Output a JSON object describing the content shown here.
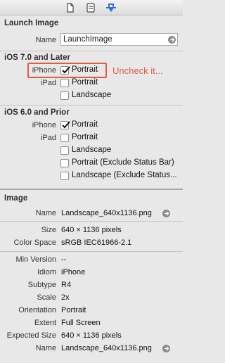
{
  "toolbar": {
    "icons": [
      "file-icon",
      "quick-help-icon",
      "attributes-inspector-icon"
    ],
    "active_color": "#2b6fd6"
  },
  "launch_image": {
    "title": "Launch Image",
    "name_label": "Name",
    "name_value": "LaunchImage"
  },
  "ios7": {
    "title": "iOS 7.0 and Later",
    "iphone_label": "iPhone",
    "iphone_portrait": {
      "label": "Portrait",
      "checked": true
    },
    "ipad_label": "iPad",
    "ipad_portrait": {
      "label": "Portrait",
      "checked": false
    },
    "ipad_landscape": {
      "label": "Landscape",
      "checked": false
    }
  },
  "annotation": {
    "text": "Uncheck it...",
    "color": "#e45a48"
  },
  "ios6": {
    "title": "iOS 6.0 and Prior",
    "iphone_label": "iPhone",
    "iphone_portrait": {
      "label": "Portrait",
      "checked": true
    },
    "ipad_label": "iPad",
    "ipad_portrait": {
      "label": "Portrait",
      "checked": false
    },
    "ipad_landscape": {
      "label": "Landscape",
      "checked": false
    },
    "ipad_portrait_exclude": {
      "label": "Portrait (Exclude Status Bar)",
      "checked": false
    },
    "ipad_landscape_exclude": {
      "label": "Landscape (Exclude Status...",
      "checked": false
    }
  },
  "image": {
    "title": "Image",
    "rows": [
      {
        "label": "Name",
        "value": "Landscape_640x1136.png"
      },
      {
        "label": "Size",
        "value": "640 × 1136 pixels"
      },
      {
        "label": "Color Space",
        "value": "sRGB IEC61966-2.1"
      },
      {
        "label": "Min Version",
        "value": "--"
      },
      {
        "label": "Idiom",
        "value": "iPhone"
      },
      {
        "label": "Subtype",
        "value": "R4"
      },
      {
        "label": "Scale",
        "value": "2x"
      },
      {
        "label": "Orientation",
        "value": "Portrait"
      },
      {
        "label": "Extent",
        "value": "Full Screen"
      },
      {
        "label": "Expected Size",
        "value": "640 × 1136 pixels"
      },
      {
        "label": "Name",
        "value": "Landscape_640x1136.png"
      }
    ]
  }
}
